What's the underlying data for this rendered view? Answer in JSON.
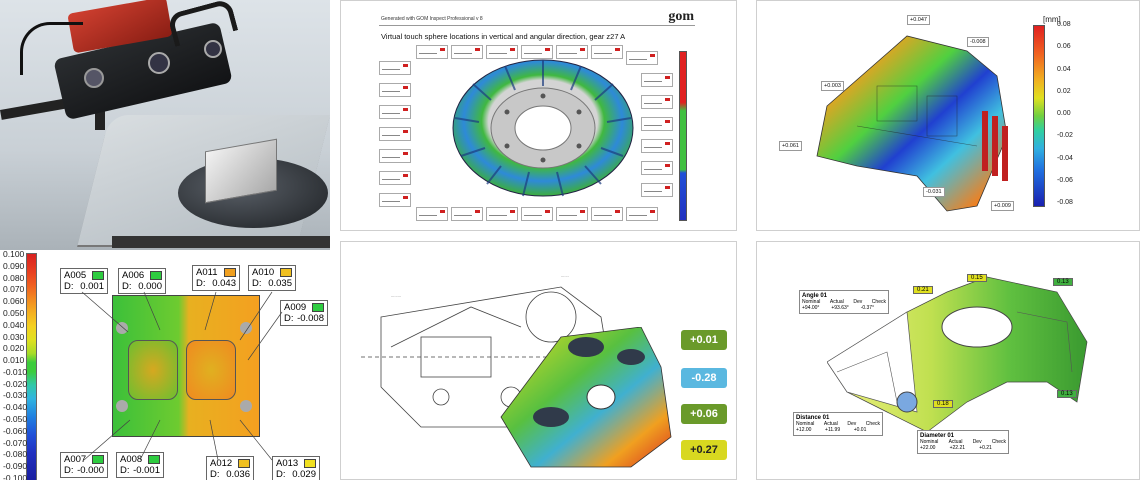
{
  "panel1": {
    "scale": [
      "0.100",
      "0.090",
      "0.080",
      "0.070",
      "0.060",
      "0.050",
      "0.040",
      "0.030",
      "0.020",
      "0.010",
      "-0.010",
      "-0.020",
      "-0.030",
      "-0.040",
      "-0.050",
      "-0.060",
      "-0.070",
      "-0.080",
      "-0.090",
      "-0.100"
    ],
    "labels": [
      {
        "name": "A005",
        "d": "D:",
        "v": "0.001",
        "color": "#2ecc40"
      },
      {
        "name": "A006",
        "d": "D:",
        "v": "0.000",
        "color": "#2ecc40"
      },
      {
        "name": "A011",
        "d": "D:",
        "v": "0.043",
        "color": "#f0a020"
      },
      {
        "name": "A010",
        "d": "D:",
        "v": "0.035",
        "color": "#f0c020"
      },
      {
        "name": "A009",
        "d": "D:",
        "v": "-0.008",
        "color": "#2ecc40"
      },
      {
        "name": "A007",
        "d": "D:",
        "v": "-0.000",
        "color": "#2ecc40"
      },
      {
        "name": "A008",
        "d": "D:",
        "v": "-0.001",
        "color": "#2ecc40"
      },
      {
        "name": "A012",
        "d": "D:",
        "v": "0.036",
        "color": "#f0c020"
      },
      {
        "name": "A013",
        "d": "D:",
        "v": "0.029",
        "color": "#f0e020"
      }
    ]
  },
  "panel2": {
    "header": "Generated with GOM Inspect Professional v 8",
    "logo": "gom",
    "title": "Virtual touch sphere locations in vertical and angular direction, gear z27 A"
  },
  "panel3": {
    "unit": "[mm]",
    "scale": [
      "0.08",
      "0.06",
      "0.04",
      "0.02",
      "0.00",
      "-0.02",
      "-0.04",
      "-0.06",
      "-0.08"
    ]
  },
  "panel4": {
    "badges": [
      {
        "text": "+0.01",
        "color": "#6a9a2a"
      },
      {
        "text": "-0.28",
        "color": "#5ab8e0"
      },
      {
        "text": "+0.06",
        "color": "#6a9a2a"
      },
      {
        "text": "+0.27",
        "color": "#d8d820"
      }
    ]
  },
  "panel5": {
    "angle": {
      "title": "Angle 01",
      "cols": [
        "Nominal",
        "Actual",
        "Dev",
        "Check"
      ],
      "vals": [
        "+94.00°",
        "+93.63°",
        "-0.37°",
        ""
      ]
    },
    "distance": {
      "title": "Distance 01",
      "cols": [
        "Nominal",
        "Actual",
        "Dev",
        "Check"
      ],
      "vals": [
        "+12.00",
        "+11.99",
        "+0.01",
        ""
      ]
    },
    "diameter": {
      "title": "Diameter 01",
      "cols": [
        "Nominal",
        "Actual",
        "Dev",
        "Check"
      ],
      "vals": [
        "+22.00",
        "+22.21",
        "+0.21",
        ""
      ]
    },
    "tags": [
      "0.21",
      "0.15",
      "0.13",
      "0.18",
      "0.13"
    ]
  }
}
